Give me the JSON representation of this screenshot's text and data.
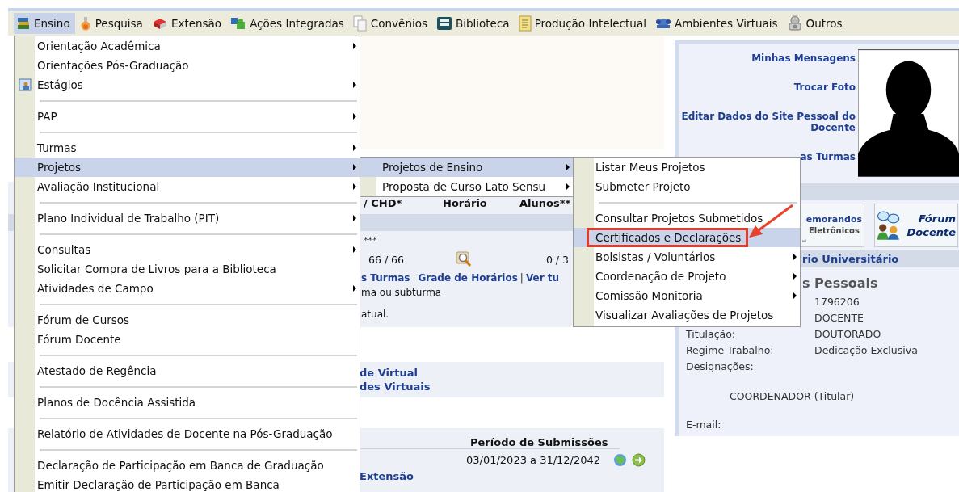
{
  "menubar": [
    {
      "label": "Ensino",
      "selected": true
    },
    {
      "label": "Pesquisa",
      "selected": false
    },
    {
      "label": "Extensão",
      "selected": false
    },
    {
      "label": "Ações Integradas",
      "selected": false
    },
    {
      "label": "Convênios",
      "selected": false
    },
    {
      "label": "Biblioteca",
      "selected": false
    },
    {
      "label": "Produção Intelectual",
      "selected": false
    },
    {
      "label": "Ambientes Virtuais",
      "selected": false
    },
    {
      "label": "Outros",
      "selected": false
    }
  ],
  "menu": [
    {
      "kind": "item",
      "label": "Orientação Acadêmica",
      "submenu": true,
      "selected": false
    },
    {
      "kind": "item",
      "label": "Orientações Pós-Graduação",
      "submenu": false,
      "selected": false
    },
    {
      "kind": "item",
      "label": "Estágios",
      "submenu": true,
      "selected": false,
      "has_icon": true
    },
    {
      "kind": "separator"
    },
    {
      "kind": "item",
      "label": "PAP",
      "submenu": true,
      "selected": false
    },
    {
      "kind": "separator"
    },
    {
      "kind": "item",
      "label": "Turmas",
      "submenu": true,
      "selected": false
    },
    {
      "kind": "item",
      "label": "Projetos",
      "submenu": true,
      "selected": true
    },
    {
      "kind": "item",
      "label": "Avaliação Institucional",
      "submenu": true,
      "selected": false
    },
    {
      "kind": "separator"
    },
    {
      "kind": "item",
      "label": "Plano Individual de Trabalho (PIT)",
      "submenu": true,
      "selected": false
    },
    {
      "kind": "separator"
    },
    {
      "kind": "item",
      "label": "Consultas",
      "submenu": true,
      "selected": false
    },
    {
      "kind": "item",
      "label": "Solicitar Compra de Livros para a Biblioteca",
      "submenu": false,
      "selected": false
    },
    {
      "kind": "item",
      "label": "Atividades de Campo",
      "submenu": true,
      "selected": false
    },
    {
      "kind": "separator"
    },
    {
      "kind": "item",
      "label": "Fórum de Cursos",
      "submenu": false,
      "selected": false
    },
    {
      "kind": "item",
      "label": "Fórum Docente",
      "submenu": false,
      "selected": false
    },
    {
      "kind": "separator"
    },
    {
      "kind": "item",
      "label": "Atestado de Regência",
      "submenu": false,
      "selected": false
    },
    {
      "kind": "separator"
    },
    {
      "kind": "item",
      "label": "Planos de Docência Assistida",
      "submenu": false,
      "selected": false
    },
    {
      "kind": "separator"
    },
    {
      "kind": "item",
      "label": "Relatório de Atividades de Docente na Pós-Graduação",
      "submenu": false,
      "selected": false
    },
    {
      "kind": "separator"
    },
    {
      "kind": "item",
      "label": "Declaração de Participação em Banca de Graduação",
      "submenu": false,
      "selected": false
    },
    {
      "kind": "item",
      "label": "Emitir Declaração de Participação em Banca",
      "submenu": false,
      "selected": false
    }
  ],
  "submenu": [
    {
      "kind": "item",
      "label": "Projetos de Ensino",
      "submenu": true,
      "selected": true
    },
    {
      "kind": "item",
      "label": "Proposta de Curso Lato Sensu",
      "submenu": true,
      "selected": false
    }
  ],
  "projects_menu": [
    {
      "kind": "item",
      "label": "Listar Meus Projetos",
      "submenu": false,
      "selected": false,
      "highlighted": false
    },
    {
      "kind": "item",
      "label": "Submeter Projeto",
      "submenu": false,
      "selected": false,
      "highlighted": false
    },
    {
      "kind": "separator"
    },
    {
      "kind": "item",
      "label": "Consultar Projetos Submetidos",
      "submenu": false,
      "selected": false,
      "highlighted": false
    },
    {
      "kind": "item",
      "label": "Certificados e Declarações",
      "submenu": false,
      "selected": true,
      "highlighted": true
    },
    {
      "kind": "item",
      "label": "Bolsistas / Voluntários",
      "submenu": true,
      "selected": false,
      "highlighted": false
    },
    {
      "kind": "item",
      "label": "Coordenação de Projeto",
      "submenu": true,
      "selected": false,
      "highlighted": false
    },
    {
      "kind": "item",
      "label": "Comissão Monitoria",
      "submenu": true,
      "selected": false,
      "highlighted": false
    },
    {
      "kind": "item",
      "label": "Visualizar Avaliações de Projetos",
      "submenu": false,
      "selected": false,
      "highlighted": false
    }
  ],
  "content": {
    "table_header": [
      "/ CHD*",
      "Horário",
      "Alunos**"
    ],
    "footnote": "***",
    "row": [
      "66 / 66",
      "0 / 3"
    ],
    "links": [
      "s Turmas",
      "Grade de Horários",
      "Ver tu"
    ],
    "link_separator": "|",
    "notes": [
      "ma ou subturma",
      "atual."
    ],
    "virtual_links": [
      "de Virtual",
      "des Virtuais"
    ],
    "submissions": {
      "header": "Período de Submissões",
      "period": "03/01/2023 a 31/12/2042",
      "link": "Extensão"
    }
  },
  "sidebar": {
    "links": [
      "Minhas Mensagens",
      "Trocar Foto",
      "Editar Dados do Site Pessoal do Docente",
      "as Turmas"
    ],
    "shortcuts": [
      {
        "lines": [
          "emorandos",
          "Eletrônicos"
        ]
      },
      {
        "lines": [
          "Fórum",
          "Docente"
        ]
      }
    ],
    "section": "rio Universitário",
    "heading": "s Pessoais",
    "fields": [
      {
        "value": "1796206"
      },
      {
        "value": "DOCENTE"
      },
      {
        "label": "Titulação:",
        "value": "DOUTORADO"
      },
      {
        "label": "Regime Trabalho:",
        "value": "Dedicação Exclusiva"
      },
      {
        "label": "Designações:"
      }
    ],
    "designation": "COORDENADOR (Titular)",
    "email_label": "E-mail:"
  }
}
